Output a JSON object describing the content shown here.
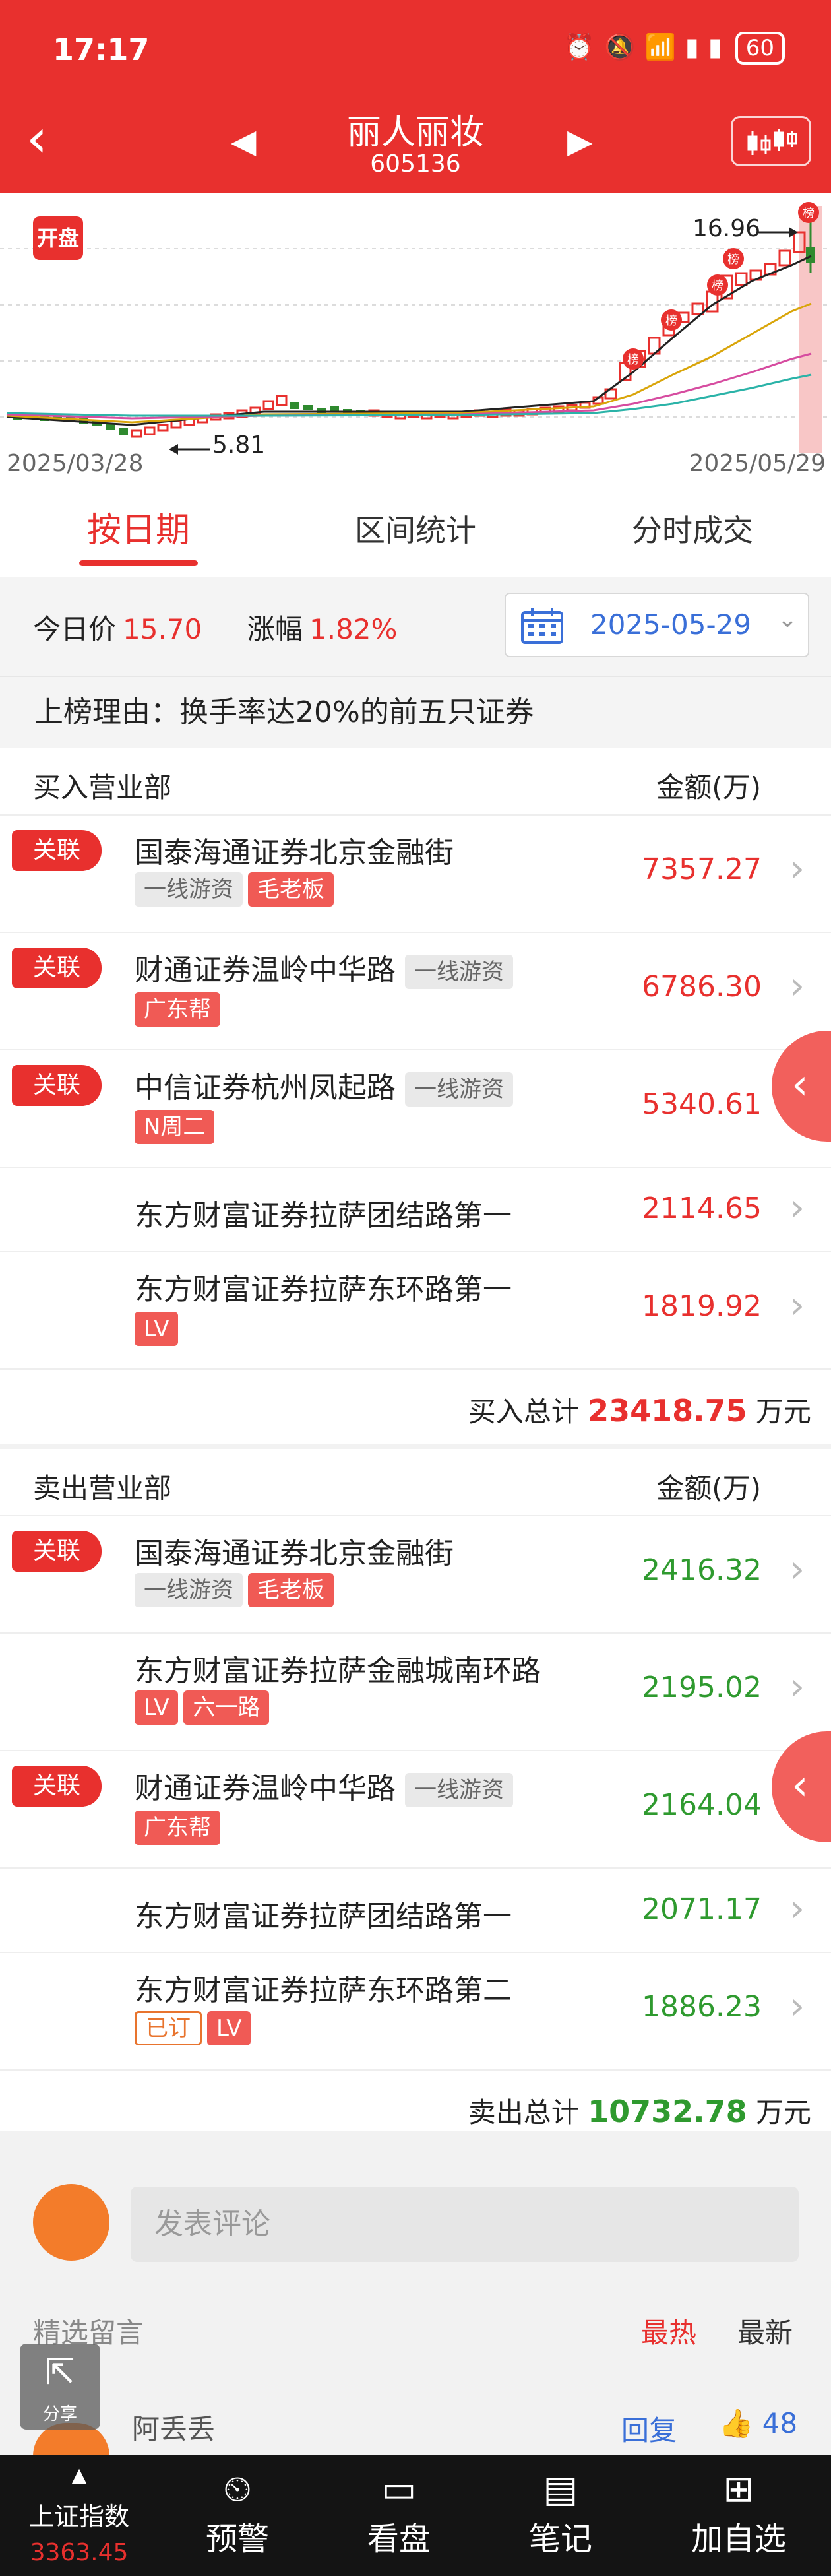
{
  "status": {
    "time": "17:17",
    "battery": "60"
  },
  "header": {
    "stock_name": "丽人丽妆",
    "stock_code": "605136",
    "kaipan": "开盘"
  },
  "chart": {
    "start_date": "2025/03/28",
    "end_date": "2025/05/29",
    "low_label": "5.81",
    "high_label": "16.96",
    "bang": "榜"
  },
  "tabs": [
    {
      "label": "按日期"
    },
    {
      "label": "区间统计"
    },
    {
      "label": "分时成交"
    }
  ],
  "price": {
    "today_label": "今日价",
    "today_value": "15.70",
    "change_label": "涨幅",
    "change_value": "1.82%",
    "date": "2025-05-29"
  },
  "reason": "上榜理由：换手率达20%的前五只证券",
  "buy": {
    "title": "买入营业部",
    "amount_header": "金额(万)",
    "rows": [
      {
        "rel": "关联",
        "name": "国泰海通证券北京金融街",
        "tags": [
          "一线游资",
          "毛老板"
        ],
        "amount": "7357.27"
      },
      {
        "rel": "关联",
        "name": "财通证券温岭中华路",
        "inline_tag": "一线游资",
        "tags": [
          "广东帮"
        ],
        "amount": "6786.30"
      },
      {
        "rel": "关联",
        "name": "中信证券杭州凤起路",
        "inline_tag": "一线游资",
        "tags": [
          "N周二"
        ],
        "amount": "5340.61"
      },
      {
        "name": "东方财富证券拉萨团结路第一",
        "amount": "2114.65"
      },
      {
        "name": "东方财富证券拉萨东环路第一",
        "tags": [
          "LV"
        ],
        "amount": "1819.92"
      }
    ],
    "total_label": "买入总计",
    "total_value": "23418.75",
    "total_unit": "万元"
  },
  "sell": {
    "title": "卖出营业部",
    "amount_header": "金额(万)",
    "rows": [
      {
        "rel": "关联",
        "name": "国泰海通证券北京金融街",
        "tags": [
          "一线游资",
          "毛老板"
        ],
        "amount": "2416.32"
      },
      {
        "name": "东方财富证券拉萨金融城南环路",
        "tags": [
          "LV",
          "六一路"
        ],
        "amount": "2195.02"
      },
      {
        "rel": "关联",
        "name": "财通证券温岭中华路",
        "inline_tag": "一线游资",
        "tags": [
          "广东帮"
        ],
        "amount": "2164.04"
      },
      {
        "name": "东方财富证券拉萨团结路第一",
        "amount": "2071.17"
      },
      {
        "name": "东方财富证券拉萨东环路第二",
        "tags": [
          "已订",
          "LV"
        ],
        "amount": "1886.23"
      }
    ],
    "total_label": "卖出总计",
    "total_value": "10732.78",
    "total_unit": "万元"
  },
  "comments": {
    "placeholder": "发表评论",
    "featured": "精选留言",
    "sort_hot": "最热",
    "sort_new": "最新",
    "share": "分享",
    "commenter": "阿丢丢",
    "reply": "回复",
    "likes": "48"
  },
  "nav": {
    "index_label": "上证指数",
    "index_value": "3363.45",
    "alert": "预警",
    "market": "看盘",
    "notes": "笔记",
    "watch": "加自选"
  },
  "colors": {
    "brand_red": "#e8302e",
    "down_green": "#2f9a2f",
    "link_blue": "#3a6fd8"
  }
}
